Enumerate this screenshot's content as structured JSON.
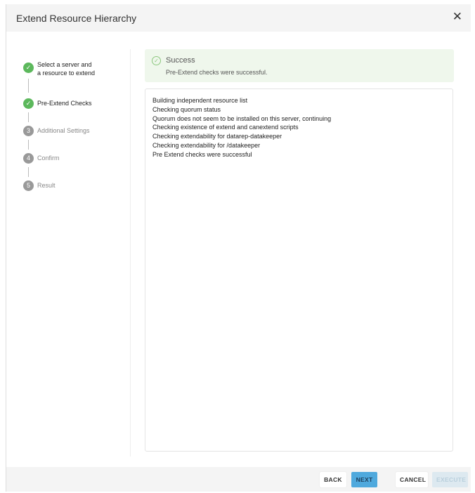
{
  "header": {
    "title": "Extend Resource Hierarchy",
    "close": "✕"
  },
  "steps": [
    {
      "num": "✓",
      "label_1": "Select a server and",
      "label_2": "a resource to extend",
      "status": "done"
    },
    {
      "num": "✓",
      "label": "Pre-Extend Checks",
      "status": "done"
    },
    {
      "num": "3",
      "label": "Additional Settings",
      "status": "pending"
    },
    {
      "num": "4",
      "label": "Confirm",
      "status": "pending"
    },
    {
      "num": "5",
      "label": "Result",
      "status": "pending"
    }
  ],
  "alert": {
    "icon": "check-circle",
    "title": "Success",
    "message": "Pre-Extend checks were successful."
  },
  "log": [
    "Building independent resource list",
    "Checking quorum status",
    "Quorum does not seem to be installed on this server, continuing",
    "Checking existence of extend and canextend scripts",
    "Checking extendability for datarep-datakeeper",
    "Checking extendability for /datakeeper",
    "Pre Extend checks were successful"
  ],
  "footer": {
    "back": "BACK",
    "next": "NEXT",
    "cancel": "CANCEL",
    "execute": "EXECUTE"
  },
  "colors": {
    "success": "#5cb85c",
    "primary": "#4fa9dd",
    "disabled": "#dde9f0"
  }
}
